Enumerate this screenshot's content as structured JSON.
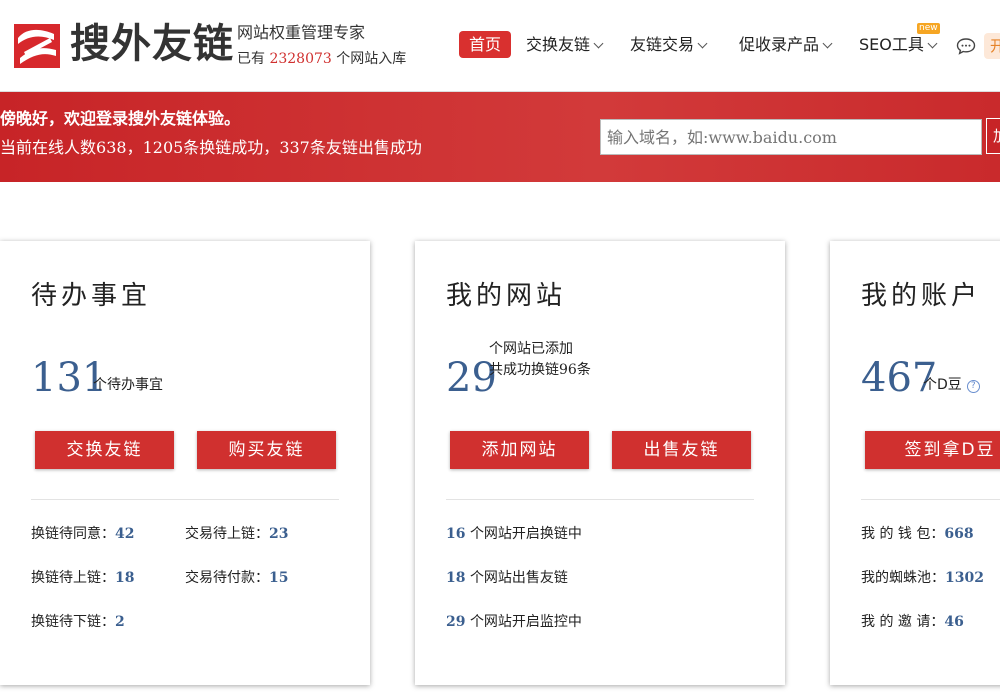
{
  "brand": {
    "name": "搜外友链",
    "slogan": "网站权重管理专家",
    "site_count_prefix": "已有",
    "site_count": "2328073",
    "site_count_suffix": "个网站入库",
    "accent_color": "#d9302f"
  },
  "nav": {
    "items": [
      {
        "label": "首页",
        "active": true
      },
      {
        "label": "交换友链",
        "dropdown": true
      },
      {
        "label": "友链交易",
        "dropdown": true
      },
      {
        "label": "促收录产品",
        "dropdown": true
      },
      {
        "label": "SEO工具",
        "dropdown": true,
        "badge": "new"
      }
    ],
    "open_label": "开"
  },
  "banner": {
    "welcome": "傍晚好，欢迎登录搜外友链体验。",
    "stats_prefix": "当前在线人数",
    "online_count": "638",
    "stats_mid1": "，",
    "exchange_count": "1205",
    "stats_mid2": "条换链成功，",
    "sold_count": "337",
    "stats_suffix": "条友链出售成功",
    "search_placeholder": "输入域名，如:www.baidu.com",
    "search_button": "加"
  },
  "cards": {
    "todo": {
      "title": "待办事宜",
      "count": "131",
      "unit": "个待办事宜",
      "buttons": [
        "交换友链",
        "购买友链"
      ],
      "stats": [
        {
          "label": "换链待同意：",
          "value": "42"
        },
        {
          "label": "交易待上链：",
          "value": "23"
        },
        {
          "label": "换链待上链：",
          "value": "18"
        },
        {
          "label": "交易待付款：",
          "value": "15"
        },
        {
          "label": "换链待下链：",
          "value": "2"
        }
      ]
    },
    "sites": {
      "title": "我的网站",
      "count": "29",
      "unit_line1": "个网站已添加",
      "unit_line2_prefix": "共成功换链",
      "unit_line2_value": "96",
      "unit_line2_suffix": "条",
      "buttons": [
        "添加网站",
        "出售友链"
      ],
      "stats": [
        {
          "value": "16",
          "label": "个网站开启换链中"
        },
        {
          "value": "18",
          "label": "个网站出售友链"
        },
        {
          "value": "29",
          "label": "个网站开启监控中"
        }
      ]
    },
    "account": {
      "title": "我的账户",
      "count": "467",
      "unit": "个D豆",
      "help": "?",
      "buttons": [
        "签到拿D豆"
      ],
      "stats": [
        {
          "label": "我 的 钱 包：",
          "value": "668"
        },
        {
          "label": "我的蜘蛛池：",
          "value": "1302"
        },
        {
          "label": "我 的 邀 请：",
          "value": "46"
        }
      ]
    }
  }
}
